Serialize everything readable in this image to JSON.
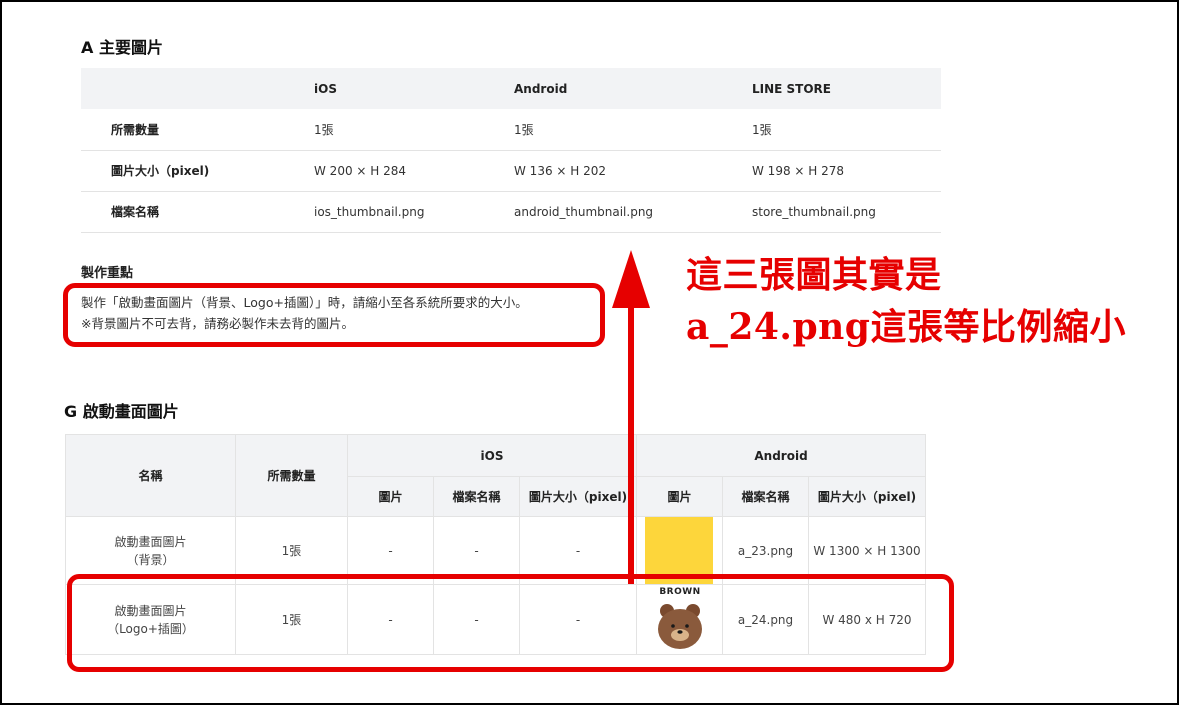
{
  "section_a": {
    "title": "A 主要圖片",
    "headers": [
      "",
      "iOS",
      "Android",
      "LINE STORE"
    ],
    "rows": [
      {
        "label": "所需數量",
        "ios": "1張",
        "android": "1張",
        "store": "1張"
      },
      {
        "label": "圖片大小（pixel)",
        "ios": "W 200 × H 284",
        "android": "W 136 × H 202",
        "store": "W 198 × H 278"
      },
      {
        "label": "檔案名稱",
        "ios": "ios_thumbnail.png",
        "android": "android_thumbnail.png",
        "store": "store_thumbnail.png"
      }
    ]
  },
  "key_points": {
    "title": "製作重點",
    "line1": "製作「啟動畫面圖片（背景、Logo+插圖）」時，請縮小至各系統所要求的大小。",
    "line2": "※背景圖片不可去背，請務必製作未去背的圖片。"
  },
  "section_g": {
    "title": "G 啟動畫面圖片",
    "headers": {
      "name": "名稱",
      "qty": "所需數量",
      "ios": "iOS",
      "android": "Android",
      "ios_img": "圖片",
      "ios_file": "檔案名稱",
      "ios_size": "圖片大小（pixel)",
      "and_img": "圖片",
      "and_file": "檔案名稱",
      "and_size": "圖片大小（pixel)"
    },
    "rows": [
      {
        "name_line1": "啟動畫面圖片",
        "name_line2": "（背景）",
        "qty": "1張",
        "ios_img": "-",
        "ios_file": "-",
        "ios_size": "-",
        "and_file": "a_23.png",
        "and_size": "W 1300 × H 1300"
      },
      {
        "name_line1": "啟動畫面圖片",
        "name_line2": "（Logo+插圖）",
        "qty": "1張",
        "ios_img": "-",
        "ios_file": "-",
        "ios_size": "-",
        "and_file": "a_24.png",
        "and_size": "W 480 x H 720",
        "img_label": "BROWN"
      }
    ]
  },
  "annotation": {
    "line1": "這三張圖其實是",
    "line2": "a_24.png這張等比例縮小",
    "color": "#e60000"
  },
  "colors": {
    "header_bg": "#f2f3f5",
    "swatch_yellow": "#fdd63b",
    "bear_brown": "#8a5a3c"
  }
}
